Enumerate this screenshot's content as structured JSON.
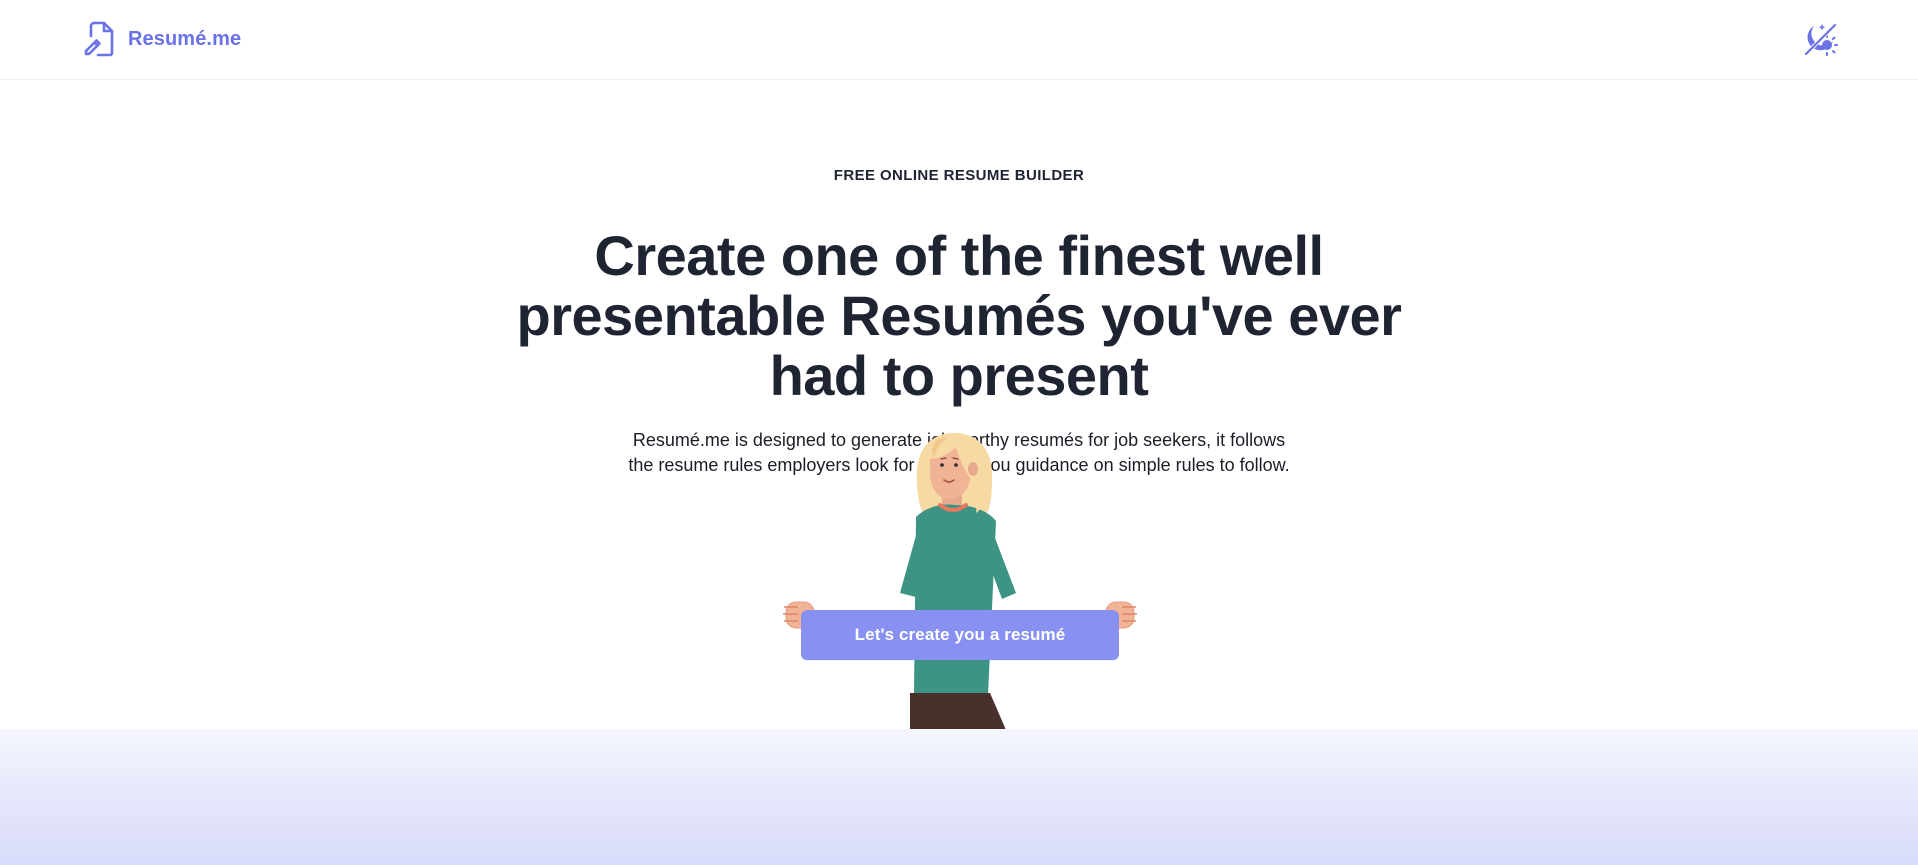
{
  "header": {
    "brand_name": "Resumé.me",
    "brand_icon": "file-edit-icon",
    "theme_toggle_icon": "moon-sun-toggle-icon"
  },
  "hero": {
    "eyebrow": "FREE ONLINE RESUME BUILDER",
    "headline_lines": [
      "Create one of the finest well",
      "presentable Resumés you've ever",
      "had to present"
    ],
    "lede_lines": [
      "Resumé.me is designed to generate job worthy resumés for job seekers, it follows",
      "the resume rules employers look for a gives you guidance on simple rules to follow."
    ],
    "cta_label": "Let's create you a resumé",
    "illustration": "person-holding-sign"
  },
  "colors": {
    "brand": "#6a72e6",
    "cta_background": "#8891f2",
    "text_dark": "#1f2433",
    "band_gradient_end": "#d8dbfa"
  }
}
